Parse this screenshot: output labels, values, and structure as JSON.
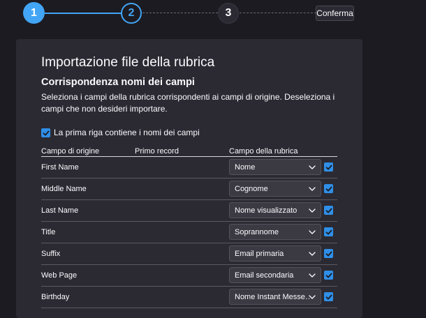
{
  "stepper": {
    "steps": [
      "1",
      "2",
      "3"
    ],
    "confirm_label": "Conferma",
    "active_color": "#42a5f5"
  },
  "panel": {
    "title": "Importazione file della rubrica",
    "subtitle": "Corrispondenza nomi dei campi",
    "description": "Seleziona i campi della rubrica corrispondenti ai campi di origine. Deseleziona i campi che non desideri importare.",
    "first_row_checkbox_label": "La prima riga contiene i nomi dei campi",
    "first_row_checked": true
  },
  "table": {
    "headers": [
      "Campo di origine",
      "Primo record",
      "Campo della rubrica"
    ],
    "rows": [
      {
        "source": "First Name",
        "first_record": "",
        "target": "Nome",
        "checked": true
      },
      {
        "source": "Middle Name",
        "first_record": "",
        "target": "Cognome",
        "checked": true
      },
      {
        "source": "Last Name",
        "first_record": "",
        "target": "Nome visualizzato",
        "checked": true
      },
      {
        "source": "Title",
        "first_record": "",
        "target": "Soprannome",
        "checked": true
      },
      {
        "source": "Suffix",
        "first_record": "",
        "target": "Email primaria",
        "checked": true
      },
      {
        "source": "Web Page",
        "first_record": "",
        "target": "Email secondaria",
        "checked": true
      },
      {
        "source": "Birthday",
        "first_record": "",
        "target": "Nome Instant Messe…",
        "checked": true
      }
    ]
  },
  "icons": {
    "select_arrow": "chevron-down-icon",
    "checkbox": "checkmark-icon"
  }
}
